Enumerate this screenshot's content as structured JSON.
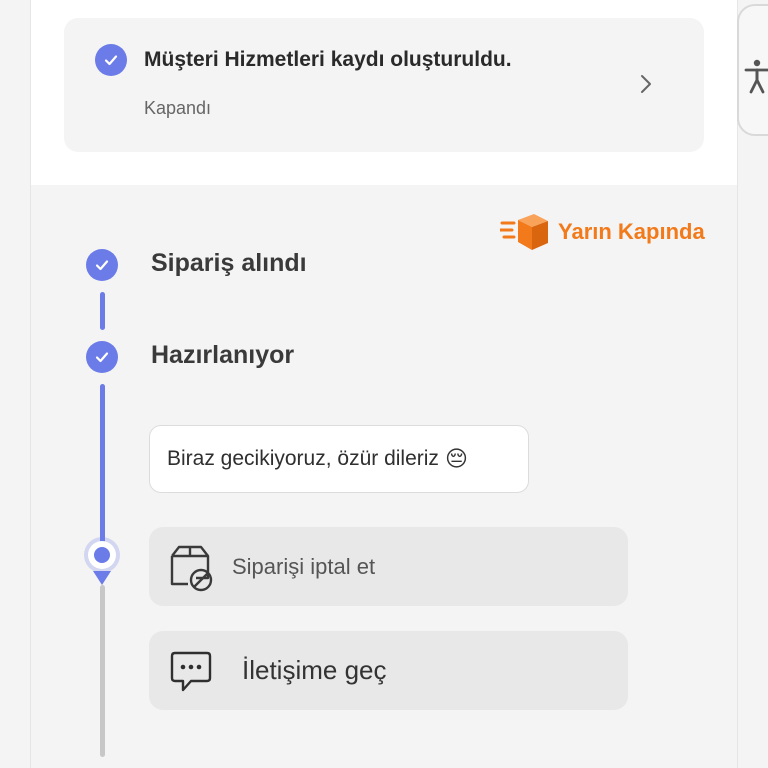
{
  "support_ticket": {
    "title": "Müşteri Hizmetleri kaydı oluşturuldu.",
    "status": "Kapandı"
  },
  "brand": {
    "label": "Yarın Kapında",
    "color": "#f27a1a",
    "icon": "fast-delivery-box-icon"
  },
  "timeline": {
    "accent_color": "#6b7ce8",
    "steps": [
      {
        "label": "Sipariş alındı",
        "state": "completed"
      },
      {
        "label": "Hazırlanıyor",
        "state": "completed"
      }
    ],
    "delay_message": "Biraz gecikiyoruz, özür dileriz",
    "delay_emoji": "😔"
  },
  "actions": {
    "cancel": {
      "label": "Siparişi iptal et",
      "icon": "package-cancel-icon"
    },
    "contact": {
      "label": "İletişime geç",
      "icon": "chat-bubble-icon"
    }
  },
  "accessibility": {
    "icon": "accessibility-person-icon"
  }
}
